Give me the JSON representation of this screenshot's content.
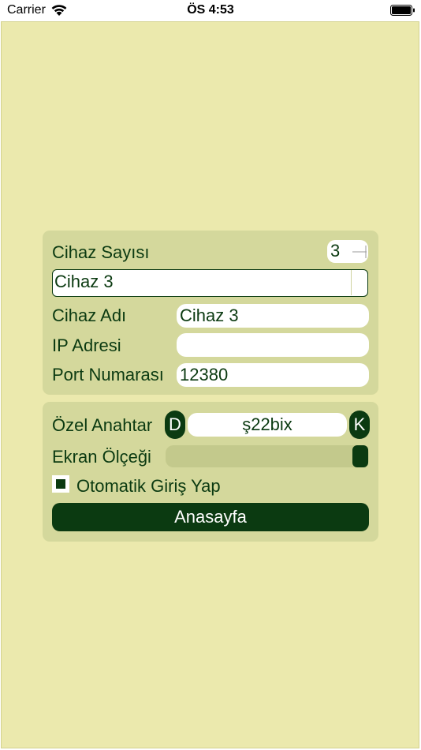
{
  "status_bar": {
    "carrier": "Carrier",
    "time": "ÖS 4:53"
  },
  "colors": {
    "background": "#ebe9ad",
    "panel": "#d4d89c",
    "accent": "#0b3a11"
  },
  "device_panel": {
    "device_count_label": "Cihaz Sayısı",
    "device_count_value": "3",
    "selected_device": "Cihaz 3",
    "device_name_label": "Cihaz Adı",
    "device_name_value": "Cihaz 3",
    "ip_label": "IP Adresi",
    "ip_value": "",
    "port_label": "Port Numarası",
    "port_value": "12380"
  },
  "settings_panel": {
    "private_key_label": "Özel Anahtar",
    "key_left_button": "D",
    "key_value": "ş22bix",
    "key_right_button": "K",
    "screen_scale_label": "Ekran Ölçeği",
    "screen_scale_value": 1.0,
    "auto_login_label": "Otomatik Giriş Yap",
    "auto_login_checked": true,
    "home_button": "Anasayfa"
  }
}
